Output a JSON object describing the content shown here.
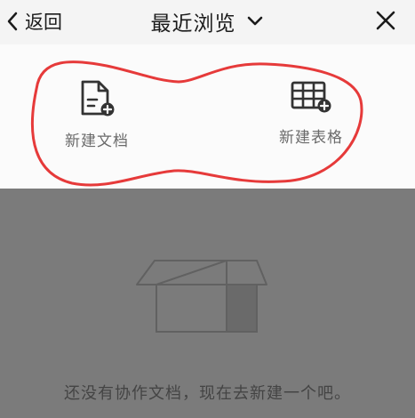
{
  "header": {
    "back_label": "返回",
    "title": "最近浏览"
  },
  "actions": [
    {
      "label": "新建文档",
      "icon": "new-document-icon"
    },
    {
      "label": "新建表格",
      "icon": "new-spreadsheet-icon"
    }
  ],
  "empty_state": {
    "message": "还没有协作文档，现在去新建一个吧。",
    "icon": "empty-box-icon"
  },
  "colors": {
    "overlay": "#7b7b7b",
    "panel": "#fbfbfb",
    "header": "#f4f4f4",
    "annotation": "#e63a3a",
    "icon": "#333333"
  }
}
